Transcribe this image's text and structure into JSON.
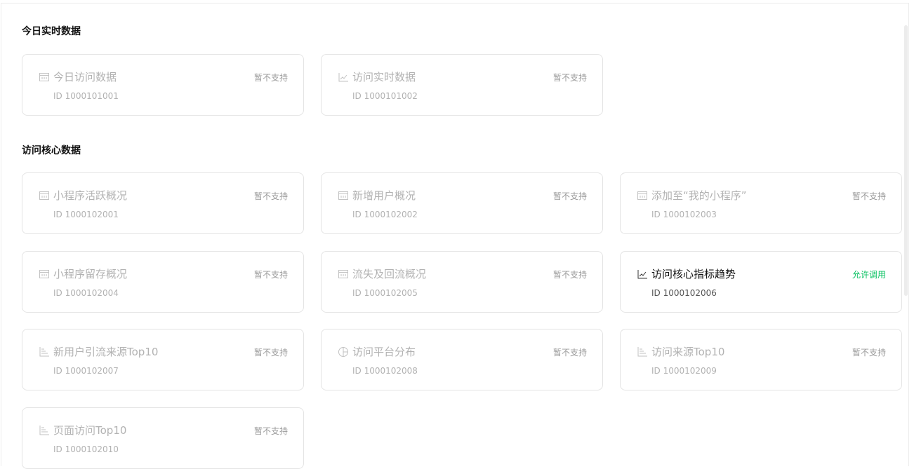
{
  "sections": {
    "today": {
      "title": "今日实时数据"
    },
    "core": {
      "title": "访问核心数据"
    }
  },
  "cards": [
    {
      "name": "今日访问数据",
      "id": "ID 1000101001",
      "status": "暂不支持",
      "icon": "table-icon"
    },
    {
      "name": "访问实时数据",
      "id": "ID 1000101002",
      "status": "暂不支持",
      "icon": "line-chart-icon"
    },
    {
      "name": "小程序活跃概况",
      "id": "ID 1000102001",
      "status": "暂不支持",
      "icon": "table-icon"
    },
    {
      "name": "新增用户概况",
      "id": "ID 1000102002",
      "status": "暂不支持",
      "icon": "table-icon"
    },
    {
      "name": "添加至“我的小程序”",
      "id": "ID 1000102003",
      "status": "暂不支持",
      "icon": "table-icon"
    },
    {
      "name": "小程序留存概况",
      "id": "ID 1000102004",
      "status": "暂不支持",
      "icon": "table-icon"
    },
    {
      "name": "流失及回流概况",
      "id": "ID 1000102005",
      "status": "暂不支持",
      "icon": "table-icon"
    },
    {
      "name": "访问核心指标趋势",
      "id": "ID 1000102006",
      "status": "允许调用",
      "icon": "line-chart-icon"
    },
    {
      "name": "新用户引流来源Top10",
      "id": "ID 1000102007",
      "status": "暂不支持",
      "icon": "bar-chart-icon"
    },
    {
      "name": "访问平台分布",
      "id": "ID 1000102008",
      "status": "暂不支持",
      "icon": "pie-chart-icon"
    },
    {
      "name": "访问来源Top10",
      "id": "ID 1000102009",
      "status": "暂不支持",
      "icon": "bar-chart-icon"
    },
    {
      "name": "页面访问Top10",
      "id": "ID 1000102010",
      "status": "暂不支持",
      "icon": "bar-chart-icon"
    }
  ],
  "colors": {
    "allowed": "#07c160",
    "disabled_text": "#b2b2b2",
    "border": "#e4e4e4"
  }
}
